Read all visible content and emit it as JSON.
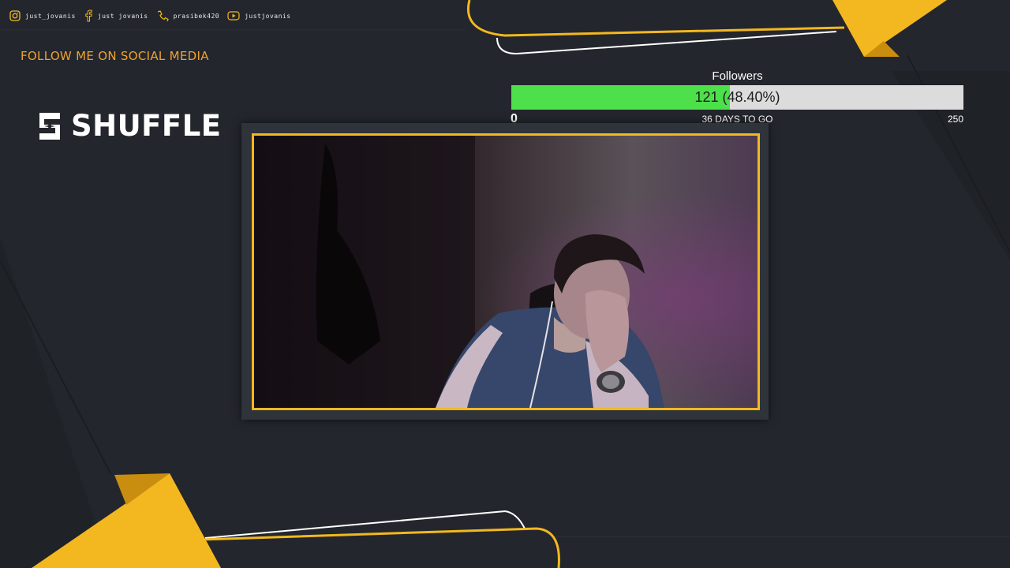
{
  "social": {
    "items": [
      {
        "icon": "instagram-icon",
        "label": "just_jovanis"
      },
      {
        "icon": "facebook-icon",
        "label": "just jovanis"
      },
      {
        "icon": "phone-icon",
        "label": "prasibek420"
      },
      {
        "icon": "youtube-icon",
        "label": "justjovanis"
      }
    ],
    "heading": "FOLLOW ME ON SOCIAL MEDIA"
  },
  "sponsor": {
    "name": "SHUFFLE",
    "icon": "shuffle-logo-icon"
  },
  "follower_goal": {
    "title": "Followers",
    "current": 121,
    "target": 250,
    "progress_fraction": 0.484,
    "progress_label": "121 (48.40%)",
    "min_label": "0",
    "max_label": "250",
    "days_label": "36 DAYS TO GO"
  },
  "colors": {
    "background": "#23262c",
    "accent_yellow": "#f3b81f",
    "heading_orange": "#f0a22c",
    "goal_fill": "#4de04a",
    "goal_track": "#dcdcdc"
  },
  "webcam": {
    "description_icon": "webcam-feed"
  }
}
